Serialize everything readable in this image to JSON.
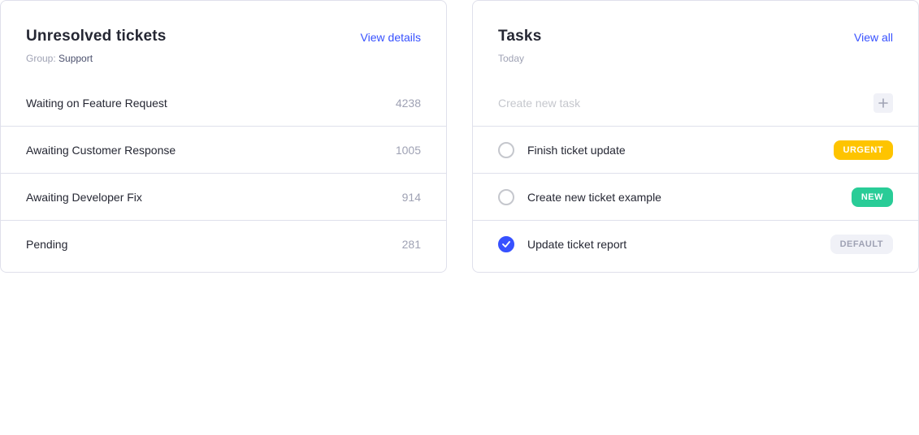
{
  "tickets": {
    "title": "Unresolved tickets",
    "link": "View details",
    "group_label": "Group:",
    "group_value": "Support",
    "items": [
      {
        "label": "Waiting on Feature Request",
        "count": "4238"
      },
      {
        "label": "Awaiting Customer Response",
        "count": "1005"
      },
      {
        "label": "Awaiting Developer Fix",
        "count": "914"
      },
      {
        "label": "Pending",
        "count": "281"
      }
    ]
  },
  "tasks": {
    "title": "Tasks",
    "link": "View all",
    "subtitle": "Today",
    "new_task_placeholder": "Create new task",
    "add_icon": "plus-icon",
    "items": [
      {
        "label": "Finish ticket update",
        "badge": "URGENT",
        "badge_color": "#fec400",
        "done": false
      },
      {
        "label": "Create new ticket example",
        "badge": "NEW",
        "badge_color": "#29cc97",
        "done": false
      },
      {
        "label": "Update ticket report",
        "badge": "DEFAULT",
        "badge_color": "#f0f1f7",
        "done": true
      }
    ]
  },
  "colors": {
    "accent": "#3751ff",
    "border": "#dfe0eb",
    "muted": "#9fa2b4"
  }
}
